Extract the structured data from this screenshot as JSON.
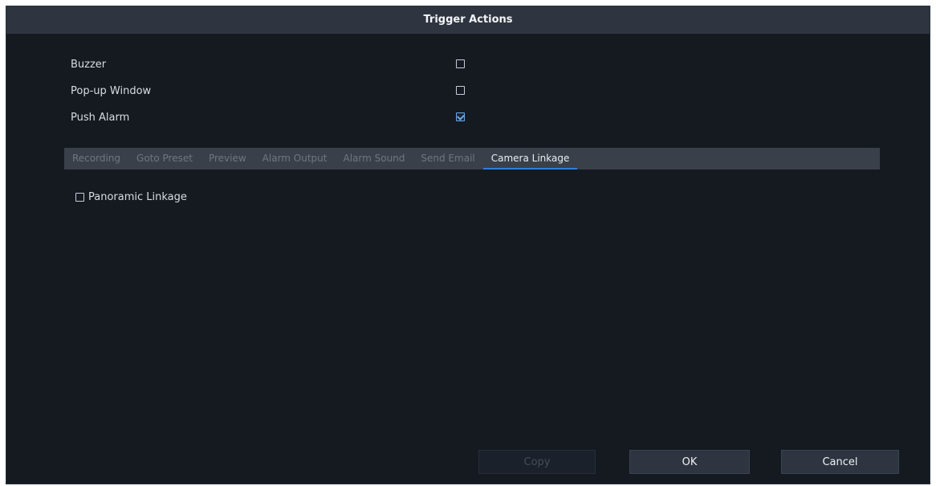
{
  "dialog": {
    "title": "Trigger Actions"
  },
  "options": [
    {
      "label": "Buzzer",
      "checked": false
    },
    {
      "label": "Pop-up Window",
      "checked": false
    },
    {
      "label": "Push Alarm",
      "checked": true
    }
  ],
  "tabs": [
    {
      "label": "Recording",
      "active": false
    },
    {
      "label": "Goto Preset",
      "active": false
    },
    {
      "label": "Preview",
      "active": false
    },
    {
      "label": "Alarm Output",
      "active": false
    },
    {
      "label": "Alarm Sound",
      "active": false
    },
    {
      "label": "Send Email",
      "active": false
    },
    {
      "label": "Camera Linkage",
      "active": true
    }
  ],
  "camera_linkage": {
    "panoramic_label": "Panoramic Linkage",
    "panoramic_checked": false
  },
  "buttons": {
    "copy_label": "Copy",
    "ok_label": "OK",
    "cancel_label": "Cancel"
  },
  "colors": {
    "background": "#151a21",
    "titlebar": "#2f3540",
    "tabbar": "#3a4049",
    "accent": "#2f7ed8"
  }
}
